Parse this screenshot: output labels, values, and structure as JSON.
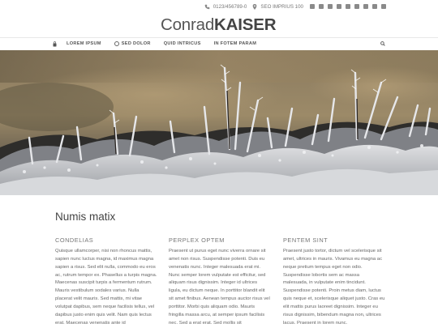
{
  "topbar": {
    "phone": "0123/456789-0",
    "address": "SEO IMPRIUS 100",
    "social_icons": [
      "mail-icon",
      "facebook-icon",
      "twitter-icon",
      "google-plus-icon",
      "linkedin-icon",
      "xing-icon",
      "instagram-icon",
      "youtube-icon",
      "pinterest-icon"
    ]
  },
  "logo": {
    "first": "Conrad",
    "last": "KAISER"
  },
  "nav": {
    "items": [
      {
        "label": "LOREM IPSUM"
      },
      {
        "label": "SED DOLOR"
      },
      {
        "label": "QUID INTRICUS"
      },
      {
        "label": "IN FOTEM PARAM"
      }
    ]
  },
  "main": {
    "title": "Numis matix",
    "columns": [
      {
        "heading": "CONDELIAS",
        "text": "Quisque ullamcorper, nisi non rhoncus mattis, sapien nunc luctus magna, id maximus magna sapien a risus. Sed elit nulla, commodo eu eros ac, rutrum tempor ex. Phasellus a turpis magna. Maecenas suscipit turpis a fermentum rutrum. Mauris vestibulum sodales varius. Nulla placerat velit mauris. Sed mattis, mi vitae volutpat dapibus, sem neque facilisis tellus, vel dapibus justo enim quis velit. Nam quis lectus erat. Maecenas venenatis ante id"
      },
      {
        "heading": "PERPLEX OPTEM",
        "text": "Praesent ut purus eget nunc viverra ornare sit amet non risus. Suspendisse potenti. Duis eu venenatis nunc. Integer malesuada erat mi. Nunc semper lorem vulputate est efficitur, sed aliquam risus dignissim. Integer id ultrices ligula, eu dictum neque. In porttitor blandit elit sit amet finibus. Aenean tempus auctor risus vel porttitor. Morbi quis aliquam odio. Mauris fringilla massa arcu, at semper ipsum facilisis nec. Sed a erat erat. Sed mollis sit"
      },
      {
        "heading": "PENTEM SINT",
        "text": "Praesent justo tortor, dictum vel scelerisque sit amet, ultrices in mauris. Vivamus eu magna ac neque pretium tempus eget non odio. Suspendisse lobortis sem ac massa malesuada, in vulputate enim tincidunt. Suspendisse potenti. Proin metus diam, luctus quis neque et, scelerisque aliquet justo. Cras eu elit mattis purus laoreet dignissim. Integer eu risus dignissim, bibendum magna non, ultrices lacus. Praesent in lorem nunc."
      }
    ]
  }
}
